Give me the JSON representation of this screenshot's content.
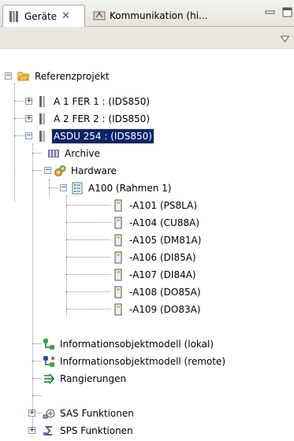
{
  "tabs": [
    {
      "label": "Geräte",
      "close": "✕",
      "icon": "devices-icon"
    },
    {
      "label": "Kommunikation (hi...",
      "icon": "communication-icon"
    }
  ],
  "window_controls": {
    "minimize": "minimize-icon",
    "maximize": "maximize-icon"
  },
  "tree": {
    "root": {
      "label": "Referenzprojekt",
      "expander": "−"
    },
    "items": [
      {
        "label": "A 1 FER 1 : (IDS850)",
        "expander": "+"
      },
      {
        "label": "A 2 FER 2 : (IDS850)",
        "expander": "+"
      },
      {
        "label": "ASDU 254 : (IDS850)",
        "expander": "−",
        "selected": true
      },
      {
        "label": "Archive"
      },
      {
        "label": "Hardware",
        "expander": "−"
      },
      {
        "label": "A100 (Rahmen 1)",
        "expander": "−"
      },
      {
        "label": "-A101 (PS8LA)"
      },
      {
        "label": "-A104 (CU88A)"
      },
      {
        "label": "-A105 (DM81A)"
      },
      {
        "label": "-A106 (DI85A)"
      },
      {
        "label": "-A107 (DI84A)"
      },
      {
        "label": "-A108 (DO85A)"
      },
      {
        "label": "-A109 (DO83A)"
      },
      {
        "label": "Informationsobjektmodell (lokal)"
      },
      {
        "label": "Informationsobjektmodell (remote)"
      },
      {
        "label": "Rangierungen"
      },
      {
        "label": "SAS Funktionen",
        "expander": "+"
      },
      {
        "label": "SPS Funktionen",
        "expander": "+"
      }
    ]
  },
  "colors": {
    "selection_bg": "#0a246a",
    "selection_text": "#ffffff",
    "folder": "#f2c04a"
  }
}
